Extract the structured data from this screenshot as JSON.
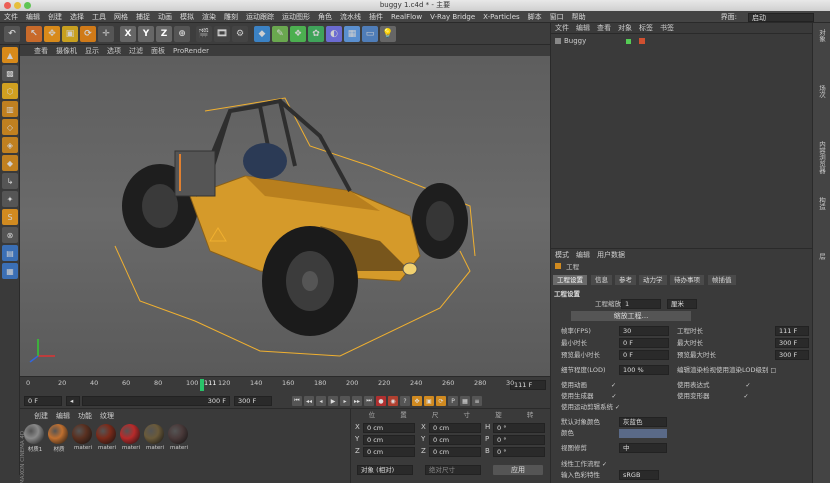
{
  "window": {
    "title": "buggy 1.c4d * - 主要"
  },
  "menubar": {
    "items": [
      "文件",
      "编辑",
      "创建",
      "选择",
      "工具",
      "网格",
      "捕捉",
      "动画",
      "模拟",
      "渲染",
      "雕刻",
      "运动跟踪",
      "运动图形",
      "角色",
      "流水线",
      "插件",
      "RealFlow",
      "V-Ray Bridge",
      "X-Particles",
      "脚本",
      "窗口",
      "帮助"
    ],
    "interface_label": "界面:",
    "interface_value": "启动"
  },
  "toolbar": {
    "x_label": "X",
    "y_label": "Y",
    "z_label": "Z"
  },
  "viewport": {
    "menu": [
      "查看",
      "摄像机",
      "显示",
      "选项",
      "过滤",
      "面板",
      "ProRender"
    ]
  },
  "timeline": {
    "ticks": [
      "0",
      "20",
      "40",
      "60",
      "80",
      "100",
      "120",
      "140",
      "160",
      "180",
      "200",
      "220",
      "240",
      "260",
      "280",
      "30"
    ],
    "current_frame": "111",
    "end_label": "111 F"
  },
  "transport": {
    "start": "0 F",
    "range_start": "0 F",
    "range_end": "300 F",
    "end": "300 F"
  },
  "materials": {
    "menu": [
      "创建",
      "编辑",
      "功能",
      "纹理"
    ],
    "items": [
      "材质1",
      "材质",
      "materi",
      "materi",
      "materi",
      "materi",
      "materi"
    ],
    "brand": "MAXON CINEMA 4D"
  },
  "coords": {
    "header": [
      "位",
      "置",
      "尺",
      "寸",
      "旋",
      "转"
    ],
    "rows": [
      {
        "axis": "X",
        "val": "0 cm",
        "axis2": "X",
        "val2": "0 cm",
        "axis3": "H",
        "val3": "0 °"
      },
      {
        "axis": "Y",
        "val": "0 cm",
        "axis2": "Y",
        "val2": "0 cm",
        "axis3": "P",
        "val3": "0 °"
      },
      {
        "axis": "Z",
        "val": "0 cm",
        "axis2": "Z",
        "val2": "0 cm",
        "axis3": "B",
        "val3": "0 °"
      }
    ],
    "mode": "对象 (相对)",
    "size_mode": "绝对尺寸",
    "apply": "应用"
  },
  "objects": {
    "menu": [
      "文件",
      "编辑",
      "查看",
      "对象",
      "标签",
      "书签"
    ],
    "item": "Buggy"
  },
  "right_strip": [
    "对象",
    "场次",
    "内容浏览器",
    "构造",
    "层"
  ],
  "attributes": {
    "menu": [
      "模式",
      "编辑",
      "用户数据"
    ],
    "title": "工程",
    "tabs": [
      "工程设置",
      "信息",
      "参考",
      "动力学",
      "待办事项",
      "帧插值"
    ],
    "section": "工程设置",
    "scale_label": "工程缩放",
    "scale_value": "1",
    "scale_unit": "厘米",
    "scale_button": "缩放工程...",
    "fps_label": "帧率(FPS)",
    "fps_value": "30",
    "min_label": "最小时长",
    "min_value": "0 F",
    "preview_min_label": "预览最小时长",
    "preview_min_value": "0 F",
    "lod_label": "细节程度(LOD)",
    "lod_value": "100 %",
    "lod_render_label": "编辑渲染检视使用渲染LOD级别",
    "time_label": "工程时长",
    "time_value": "111 F",
    "max_label": "最大时长",
    "max_value": "300 F",
    "preview_max_label": "预览最大时长",
    "preview_max_value": "300 F",
    "use_anim": "使用动画",
    "use_expr": "使用表达式",
    "use_gen": "使用生成器",
    "use_deform": "使用变形器",
    "use_motion": "使用运动剪辑系统",
    "default_color_label": "默认对象颜色",
    "default_color_value": "灰蓝色",
    "color_label": "颜色",
    "view_clip_label": "视图修剪",
    "view_clip_value": "中",
    "linear_label": "线性工作流程",
    "input_color_label": "输入色彩特性",
    "input_color_value": "sRGB"
  },
  "colors": {
    "accent_orange": "#e9a23b",
    "panel": "#3a3a3a"
  }
}
